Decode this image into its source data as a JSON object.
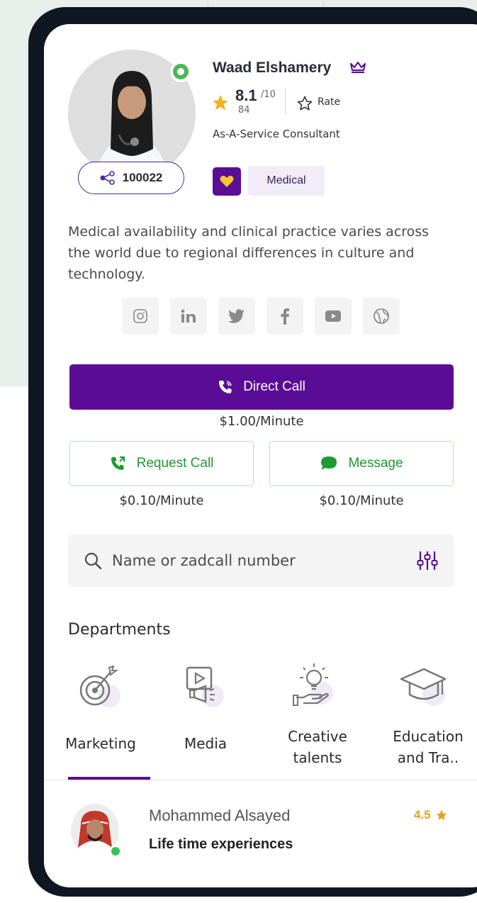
{
  "profile": {
    "name": "Waad Elshamery",
    "score": "8.1",
    "score_max": "/10",
    "review_count": "84",
    "rate_label": "Rate",
    "role": "As-A-Service Consultant",
    "share_number": "100022",
    "category": "Medical",
    "bio": "Medical availability and clinical practice varies across the world due to regional differences in culture and technology."
  },
  "socials": [
    "instagram-icon",
    "linkedin-icon",
    "twitter-icon",
    "facebook-icon",
    "youtube-icon",
    "website-icon"
  ],
  "actions": {
    "direct_call_label": "Direct Call",
    "direct_call_price": "$1.00/Minute",
    "request_call_label": "Request Call",
    "request_call_price": "$0.10/Minute",
    "message_label": "Message",
    "message_price": "$0.10/Minute"
  },
  "search": {
    "placeholder": "Name or zadcall number"
  },
  "departments": {
    "title": "Departments",
    "items": [
      {
        "label": "Marketing",
        "icon": "target-icon"
      },
      {
        "label": "Media",
        "icon": "media-icon"
      },
      {
        "label": "Creative talents",
        "icon": "lightbulb-hand-icon"
      },
      {
        "label": "Education and Tra..",
        "icon": "graduation-cap-icon"
      }
    ],
    "selected": "Marketing"
  },
  "consultant": {
    "name": "Mohammed Alsayed",
    "tagline": "Life time experiences",
    "rating": "4.5"
  },
  "colors": {
    "primary": "#5a0c96",
    "green": "#1d9a2f",
    "gold": "#e7a21b",
    "online": "#4ab856"
  }
}
